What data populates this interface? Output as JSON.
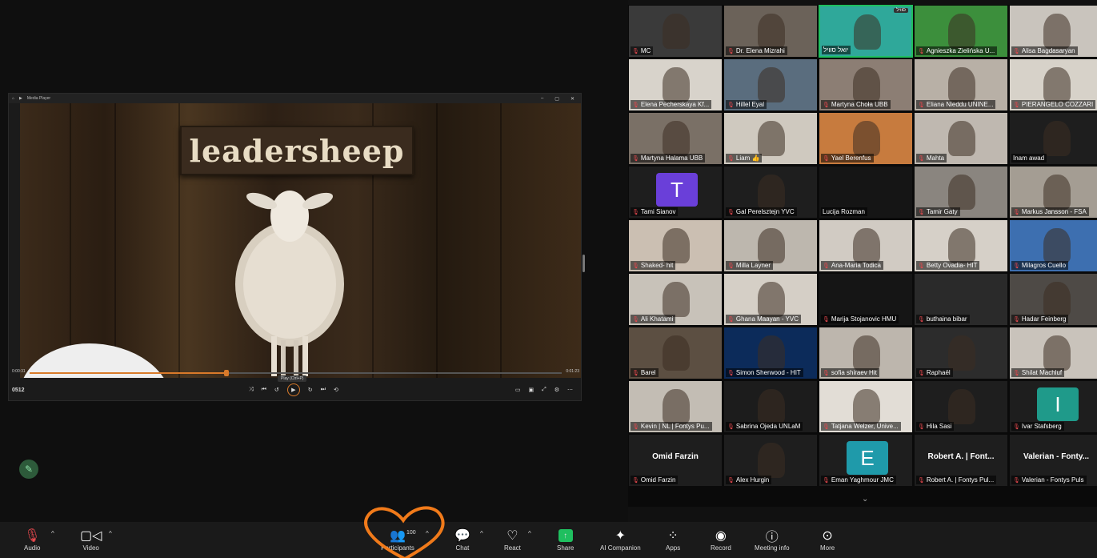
{
  "media_player": {
    "title": "Media Player",
    "slide_text": "leadersheep",
    "time_elapsed": "0:00:31",
    "time_total": "0:01:23",
    "progress": 0.37,
    "tooltip": "Play (Ctrl+P)",
    "left_label": "0512"
  },
  "gallery": {
    "participants": [
      {
        "name": "MC",
        "muted": true,
        "bg": "#3a3a3a"
      },
      {
        "name": "Dr. Elena Mizrahi",
        "muted": true,
        "bg": "#6b6259"
      },
      {
        "name": "יואל סוויל",
        "muted": false,
        "bg": "#2fa89a",
        "active": true,
        "badge": "סוויל"
      },
      {
        "name": "Agnieszka Zielińska U...",
        "muted": true,
        "bg": "#3c8f3c"
      },
      {
        "name": "Alisa Bagdasaryan",
        "muted": true,
        "bg": "#c9c4bd"
      },
      {
        "name": "Elena Pecherskaya Kf...",
        "muted": true,
        "bg": "#d8d3cb"
      },
      {
        "name": "Hillel Eyal",
        "muted": true,
        "bg": "#5a6d7e"
      },
      {
        "name": "Martyna Choła UBB",
        "muted": true,
        "bg": "#8c7e74"
      },
      {
        "name": "Eliana Nieddu UNINE...",
        "muted": true,
        "bg": "#b8b0a6"
      },
      {
        "name": "PIERANGELO COZZARI",
        "muted": true,
        "bg": "#d7d2c9"
      },
      {
        "name": "Martyna Halama UBB",
        "muted": true,
        "bg": "#7a7066"
      },
      {
        "name": "Liam 👍",
        "muted": true,
        "bg": "#cfc9bf"
      },
      {
        "name": "Yael Berenfus",
        "muted": true,
        "bg": "#c77b3e"
      },
      {
        "name": "Mahta",
        "muted": true,
        "bg": "#bfb8b0"
      },
      {
        "name": "Inam awad",
        "muted": false,
        "bg": "#1e1e1e"
      },
      {
        "name": "Tami Sianov",
        "muted": true,
        "bg": "#1e1e1e",
        "avatar": "T",
        "avatar_color": "#6a3fd9"
      },
      {
        "name": "Gal Perelsztejn YVC",
        "muted": true,
        "bg": "#1e1e1e"
      },
      {
        "name": "Lucija Rozman",
        "muted": false,
        "bg": "#151515"
      },
      {
        "name": "Tamir Gaty",
        "muted": true,
        "bg": "#8a857f"
      },
      {
        "name": "Markus Jansson - FSA",
        "muted": true,
        "bg": "#a49d93"
      },
      {
        "name": "Shaked- hit",
        "muted": true,
        "bg": "#cbbfb2"
      },
      {
        "name": "Milla Layner",
        "muted": true,
        "bg": "#bdb7ae"
      },
      {
        "name": "Ana-Maria Todica",
        "muted": true,
        "bg": "#d1cbc3"
      },
      {
        "name": "Betty Ovadia- HIT",
        "muted": true,
        "bg": "#d6d0c8"
      },
      {
        "name": "Milagros Cuello",
        "muted": true,
        "bg": "#3d6fb0"
      },
      {
        "name": "Ali Khatami",
        "muted": true,
        "bg": "#c8c2b9"
      },
      {
        "name": "Ghana Maayan - YVC",
        "muted": true,
        "bg": "#d5cfc6"
      },
      {
        "name": "Marija Stojanovic HMU",
        "muted": true,
        "bg": "#151515"
      },
      {
        "name": "buthaina bibar",
        "muted": true,
        "bg": "#2a2a2a"
      },
      {
        "name": "Hadar Feinberg",
        "muted": true,
        "bg": "#4e4a46"
      },
      {
        "name": "Barel",
        "muted": true,
        "bg": "#5c4f42"
      },
      {
        "name": "Simon Sherwood - HIT",
        "muted": true,
        "bg": "#0c2b5a"
      },
      {
        "name": "sofia shiraev Hit",
        "muted": true,
        "bg": "#bdb6ad"
      },
      {
        "name": "Raphaël",
        "muted": true,
        "bg": "#2c2c2c"
      },
      {
        "name": "Shilat Machluf",
        "muted": true,
        "bg": "#c9c3bb"
      },
      {
        "name": "Kevin | NL | Fontys Pu...",
        "muted": true,
        "bg": "#c3bdb4"
      },
      {
        "name": "Sabrina Ojeda UNLaM",
        "muted": true,
        "bg": "#1c1c1c"
      },
      {
        "name": "Tatjana Welzer, Unive...",
        "muted": true,
        "bg": "#e2ddd6"
      },
      {
        "name": "Hila Sasi",
        "muted": true,
        "bg": "#1e1e1e"
      },
      {
        "name": "Ivar Stafsberg",
        "muted": true,
        "bg": "#1e1e1e",
        "avatar": "I",
        "avatar_color": "#1f9a8a"
      },
      {
        "name": "Omid Farzin",
        "muted": true,
        "bg": "#1e1e1e",
        "big_name": "Omid Farzin"
      },
      {
        "name": "Alex Hurgin",
        "muted": true,
        "bg": "#1e1e1e"
      },
      {
        "name": "Eman Yaghmour JMC",
        "muted": true,
        "bg": "#1e1e1e",
        "avatar": "E",
        "avatar_color": "#1f9aaa"
      },
      {
        "name": "Robert A. | Fontys Pul...",
        "muted": true,
        "bg": "#1e1e1e",
        "big_name": "Robert A. | Font..."
      },
      {
        "name": "Valerian - Fontys Puls",
        "muted": true,
        "bg": "#1e1e1e",
        "big_name": "Valerian - Fonty..."
      }
    ]
  },
  "toolbar": {
    "audio": "Audio",
    "video": "Video",
    "participants": "Participants",
    "participants_count": "100",
    "chat": "Chat",
    "react": "React",
    "share": "Share",
    "ai_companion": "AI Companion",
    "apps": "Apps",
    "record": "Record",
    "meeting_info": "Meeting info",
    "more": "More"
  },
  "colors": {
    "accent": "#1fbf5f",
    "mute": "#e5484d",
    "annotation": "#f07a1a",
    "progress": "#d97a2a"
  }
}
